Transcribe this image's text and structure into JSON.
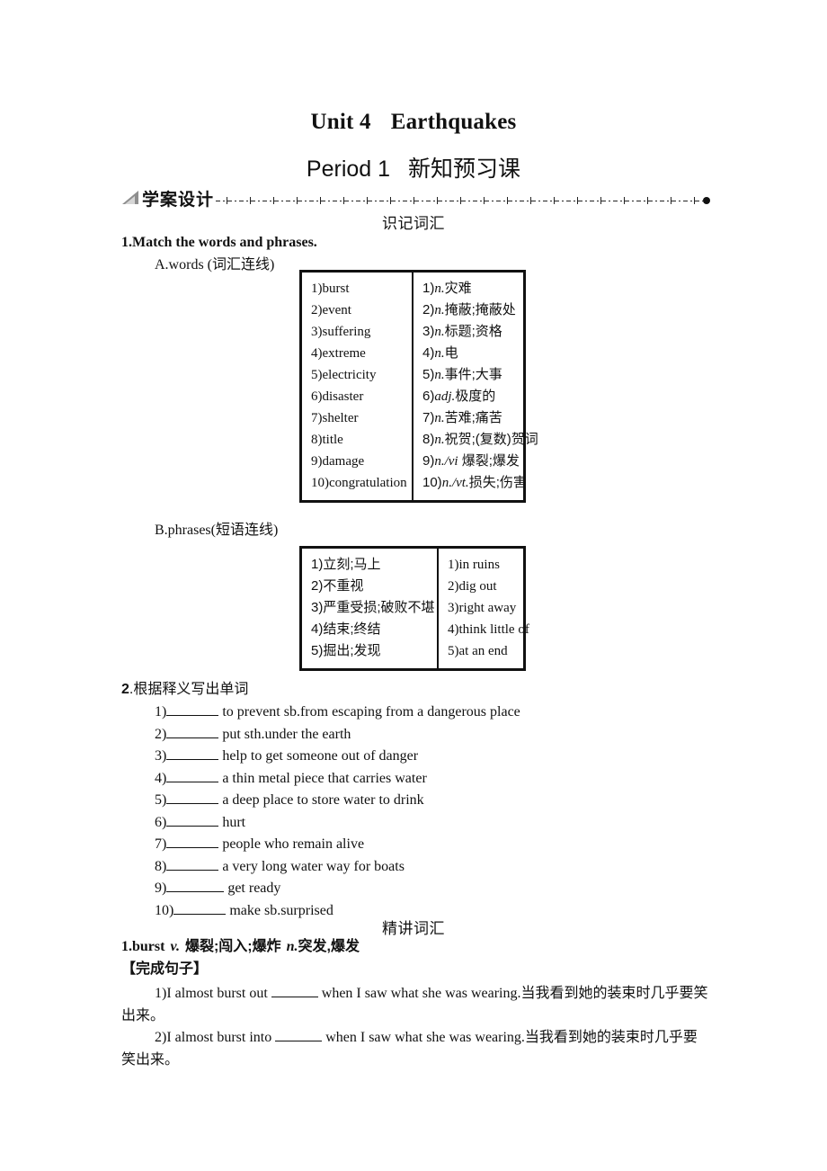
{
  "header": {
    "unit_title_left": "Unit 4",
    "unit_title_right": "Earthquakes",
    "period_left": "Period 1",
    "period_right": "新知预习课"
  },
  "banner": {
    "title": "学案设计"
  },
  "sections": {
    "memorize_vocab": "识记词汇",
    "intensive_vocab": "精讲词汇"
  },
  "exercise1": {
    "label": "1.Match the words and phrases.",
    "part_a_label": "A.words (词汇连线)",
    "part_b_label": "B.phrases(短语连线)",
    "words_table": {
      "left": [
        "1)burst",
        "2)event",
        "3)suffering",
        "4)extreme",
        "5)electricity",
        "6)disaster",
        "7)shelter",
        "8)title",
        "9)damage",
        "10)congratulation"
      ],
      "right": [
        {
          "num": "1)",
          "pos": "n.",
          "gloss": "灾难"
        },
        {
          "num": "2)",
          "pos": "n.",
          "gloss": "掩蔽;掩蔽处"
        },
        {
          "num": "3)",
          "pos": "n.",
          "gloss": "标题;资格"
        },
        {
          "num": "4)",
          "pos": "n.",
          "gloss": "电"
        },
        {
          "num": "5)",
          "pos": "n.",
          "gloss": "事件;大事"
        },
        {
          "num": "6)",
          "pos": "adj.",
          "gloss": "极度的"
        },
        {
          "num": "7)",
          "pos": "n.",
          "gloss": "苦难;痛苦"
        },
        {
          "num": "8)",
          "pos": "n.",
          "gloss": "祝贺;(复数)贺词"
        },
        {
          "num": "9)",
          "pos": "n./vi",
          "gloss": " 爆裂;爆发"
        },
        {
          "num": "10)",
          "pos": "n./vt.",
          "gloss": "损失;伤害"
        }
      ]
    },
    "phrases_table": {
      "left": [
        "1)立刻;马上",
        "2)不重视",
        "3)严重受损;破败不堪",
        "4)结束;终结",
        "5)掘出;发现"
      ],
      "right": [
        "1)in ruins",
        "2)dig out",
        "3)right away",
        "4)think little of",
        "5)at an end"
      ]
    }
  },
  "exercise2": {
    "number": "2",
    "label": ".根据释义写出单词",
    "items": [
      {
        "num": "1)",
        "blank_w": 58,
        "text": " to prevent sb.from escaping from a dangerous place"
      },
      {
        "num": "2)",
        "blank_w": 58,
        "text": " put sth.under the earth"
      },
      {
        "num": "3)",
        "blank_w": 58,
        "text": " help to get someone out of danger"
      },
      {
        "num": "4)",
        "blank_w": 58,
        "text": " a thin metal piece that carries water"
      },
      {
        "num": "5)",
        "blank_w": 58,
        "text": " a deep place to store water to drink"
      },
      {
        "num": "6)",
        "blank_w": 58,
        "text": " hurt"
      },
      {
        "num": "7)",
        "blank_w": 58,
        "text": " people who remain alive"
      },
      {
        "num": "8)",
        "blank_w": 58,
        "text": " a very long water way for boats"
      },
      {
        "num": "9)",
        "blank_w": 64,
        "text": " get ready"
      },
      {
        "num": "10)",
        "blank_w": 58,
        "text": " make sb.surprised"
      }
    ]
  },
  "entry": {
    "number": "1.",
    "word": "burst",
    "pos1": "v.",
    "gloss1": "爆裂;闯入;爆炸",
    "pos2": "n.",
    "gloss2": "突发,爆发",
    "complete_sentence_label": "【完成句子】",
    "sentences": [
      {
        "num": "1)",
        "before": "I almost burst out ",
        "after": " when I saw what she was wearing.当我看到她的装束时几乎要笑出来。"
      },
      {
        "num": "2)",
        "before": "I almost burst into ",
        "after": " when I saw what she was wearing.当我看到她的装束时几乎要笑出来。"
      }
    ]
  }
}
